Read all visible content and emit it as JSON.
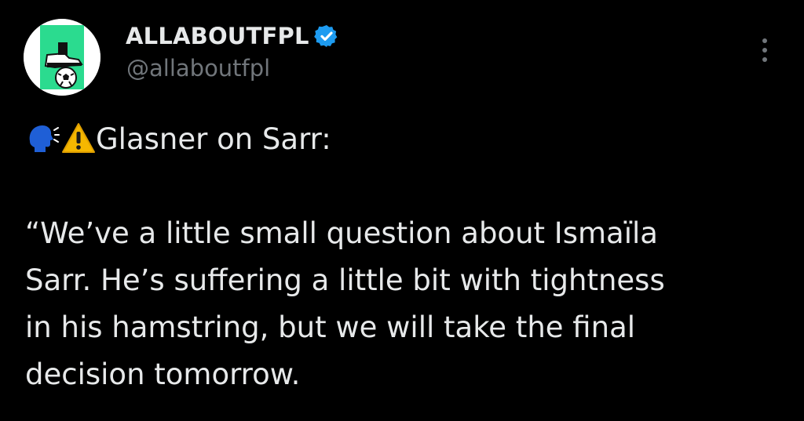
{
  "author": {
    "display_name": "ALLABOUTFPL",
    "handle": "@allaboutfpl",
    "verified": true
  },
  "menu": {
    "icon": "more-vertical-icon"
  },
  "tweet": {
    "emoji_icons": [
      "speaking-head-icon",
      "warning-icon"
    ],
    "headline": "Glasner on Sarr:",
    "quote_lines": [
      "“We’ve a little small question about Ismaïla",
      "Sarr. He’s suffering a little bit with tightness",
      "in his hamstring, but we will take the final",
      "decision tomorrow."
    ]
  },
  "colors": {
    "background": "#000000",
    "text": "#e7e9ea",
    "secondary_text": "#71767b",
    "verified_badge": "#1d9bf0",
    "avatar_green": "#2bdb8f"
  }
}
